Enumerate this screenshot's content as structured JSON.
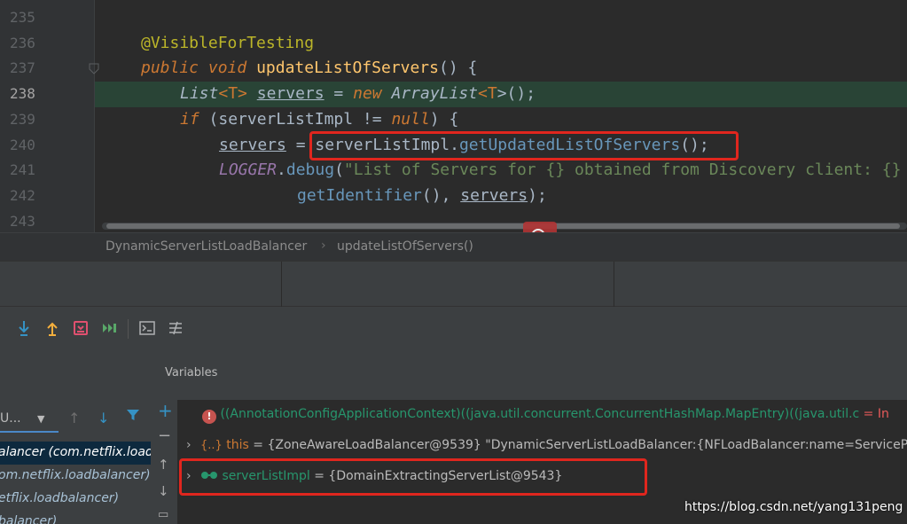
{
  "editor": {
    "lines": [
      {
        "num": "235"
      },
      {
        "num": "236",
        "annotation": "@VisibleForTesting"
      },
      {
        "num": "237",
        "kw1": "public",
        "kw2": "void",
        "method": "updateListOfServers",
        "rest": "() {"
      },
      {
        "num": "238",
        "type": "List",
        "gen_open": "<",
        "gen_t": "T",
        "gen_close": ">",
        "var": "servers",
        "eq": " = ",
        "kw_new": "new",
        "type2": "ArrayList",
        "gen_t2": "T",
        "rest": ">();"
      },
      {
        "num": "239",
        "kw_if": "if",
        "cond": " (serverListImpl != ",
        "kw_null": "null",
        "rest": ") {"
      },
      {
        "num": "240",
        "var": "servers",
        "eq": " = ",
        "obj": "serverListImpl",
        "dot": ".",
        "call": "getUpdatedListOfServers",
        "rest": "();"
      },
      {
        "num": "241",
        "logger": "LOGGER",
        "dot": ".",
        "call": "debug",
        "open": "(",
        "str": "\"List of Servers for {} obtained from Discovery client: {}"
      },
      {
        "num": "242",
        "call": "getIdentifier",
        "mid": "(), ",
        "var": "servers",
        "rest": ");"
      },
      {
        "num": "243"
      }
    ]
  },
  "breadcrumb": {
    "class_name": "DynamicServerListLoadBalancer",
    "separator": "›",
    "method_name": "updateListOfServers()"
  },
  "debug": {
    "variables_label": "Variables",
    "thread_selector": "U...",
    "frames": [
      "alancer (com.netflix.loadb",
      "om.netflix.loadbalancer)",
      "etflix.loadbalancer)",
      "balancer)"
    ],
    "variables": [
      {
        "kind": "error",
        "text": "((AnnotationConfigApplicationContext)((java.util.concurrent.ConcurrentHashMap.MapEntry)((java.util.c",
        "suffix": " = In"
      },
      {
        "kind": "object",
        "icon": "{..}",
        "name": "this",
        "value": " = {ZoneAwareLoadBalancer@9539} \"DynamicServerListLoadBalancer:{NFLoadBalancer:name=ServicePr"
      },
      {
        "kind": "field",
        "icon": "oo",
        "name": "serverListImpl",
        "value": " = {DomainExtractingServerList@9543}"
      }
    ]
  },
  "watermark": "https://blog.csdn.net/yang131peng",
  "colors": {
    "editor_bg": "#2b2b2b",
    "highlight_line": "#294436",
    "annotation_red": "#e0261e",
    "keyword": "#cc7832",
    "method": "#ffc66d",
    "string": "#6a8759",
    "field": "#9876aa"
  }
}
